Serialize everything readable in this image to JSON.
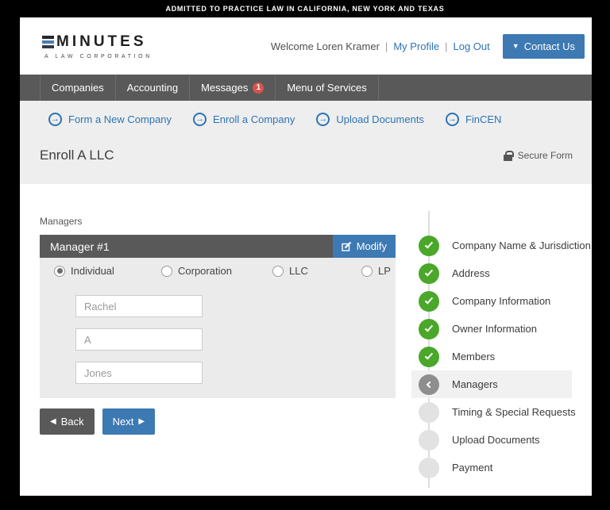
{
  "banner": {
    "text": "ADMITTED TO PRACTICE LAW IN CALIFORNIA, NEW YORK AND TEXAS"
  },
  "header": {
    "logo_text": "MINUTES",
    "logo_subtitle": "A LAW CORPORATION",
    "welcome_text": "Welcome Loren Kramer",
    "separator": "|",
    "my_profile_label": "My Profile",
    "log_out_label": "Log Out",
    "contact_button": {
      "icon": "▼",
      "label": "Contact Us"
    }
  },
  "nav": {
    "items": [
      {
        "label": "Companies"
      },
      {
        "label": "Accounting"
      },
      {
        "label": "Messages",
        "badge": "1"
      },
      {
        "label": "Menu of Services"
      }
    ]
  },
  "quick_links": [
    {
      "label": "Form a New Company"
    },
    {
      "label": "Enroll a Company"
    },
    {
      "label": "Upload Documents"
    },
    {
      "label": "FinCEN"
    }
  ],
  "page": {
    "title": "Enroll A LLC",
    "secure_label": "Secure Form"
  },
  "form": {
    "section_label": "Managers",
    "panel_title": "Manager #1",
    "modify_label": "Modify",
    "entity_types": [
      {
        "label": "Individual",
        "selected": true
      },
      {
        "label": "Corporation",
        "selected": false
      },
      {
        "label": "LLC",
        "selected": false
      },
      {
        "label": "LP",
        "selected": false
      }
    ],
    "fields": [
      {
        "name": "first-name",
        "value": "Rachel"
      },
      {
        "name": "middle-name",
        "value": "A"
      },
      {
        "name": "last-name",
        "value": "Jones"
      }
    ],
    "back_label": "Back",
    "next_label": "Next"
  },
  "progress": {
    "steps": [
      {
        "label": "Company Name & Jurisdiction",
        "status": "complete"
      },
      {
        "label": "Address",
        "status": "complete"
      },
      {
        "label": "Company Information",
        "status": "complete"
      },
      {
        "label": "Owner Information",
        "status": "complete"
      },
      {
        "label": "Members",
        "status": "complete"
      },
      {
        "label": "Managers",
        "status": "current"
      },
      {
        "label": "Timing & Special Requests",
        "status": "upcoming"
      },
      {
        "label": "Upload Documents",
        "status": "upcoming"
      },
      {
        "label": "Payment",
        "status": "upcoming"
      }
    ]
  },
  "icons": {
    "arrow": "→",
    "caret_down": "▼",
    "back": "◀",
    "next": "▶"
  },
  "colors": {
    "accent_blue": "#3d79b3",
    "link_blue": "#2d73b5",
    "nav_gray": "#595959",
    "success_green": "#4aa72a",
    "badge_red": "#d9534f",
    "band_gray": "#eeeeee"
  }
}
